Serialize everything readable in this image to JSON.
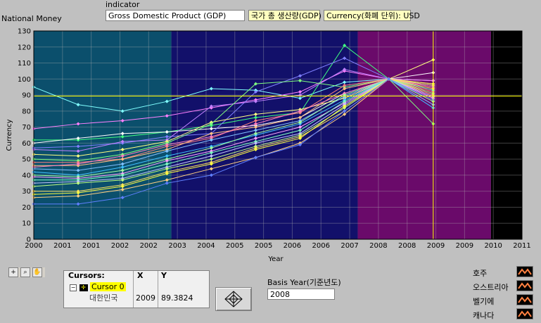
{
  "header": {
    "graph_title": "National Money",
    "indicator_label": "indicator",
    "indicator_value": "Gross Domestic Product (GDP)",
    "tag_korean": "국가 총 생산량(GDP)",
    "tag_currency": "Currency(화폐 단위): USD"
  },
  "chart_data": {
    "type": "line",
    "xlabel": "Year",
    "ylabel": "Currency",
    "xlim": [
      2000,
      2011
    ],
    "ylim": [
      0,
      130
    ],
    "x_ticks": [
      "2000",
      "2001",
      "2001",
      "2002",
      "2002",
      "2003",
      "2004",
      "2005",
      "2005",
      "2006",
      "2006",
      "2007",
      "2008",
      "2008",
      "2009",
      "2009",
      "2010",
      "2011"
    ],
    "y_ticks": [
      "0",
      "10",
      "20",
      "30",
      "40",
      "50",
      "60",
      "70",
      "80",
      "90",
      "100",
      "110",
      "120",
      "130"
    ],
    "x": [
      2000,
      2001,
      2002,
      2003,
      2004,
      2005,
      2006,
      2007,
      2008,
      2009
    ],
    "background_bands": [
      {
        "from": 2000,
        "to": 2003.1,
        "color": "#0b4f6c"
      },
      {
        "from": 2003.1,
        "to": 2007.3,
        "color": "#12106a"
      },
      {
        "from": 2007.3,
        "to": 2010.3,
        "color": "#6a0a6a"
      },
      {
        "from": 2010.3,
        "to": 2011,
        "color": "#000000"
      }
    ],
    "cursor": {
      "x": 2009,
      "y": 89.3824,
      "color": "#ffff00"
    },
    "series": [
      {
        "color": "#80ffff",
        "values": [
          95,
          84,
          80,
          86,
          94,
          93,
          88,
          98,
          100,
          99
        ]
      },
      {
        "color": "#ff80ff",
        "values": [
          69,
          72,
          74,
          77,
          82,
          87,
          92,
          105,
          100,
          99
        ]
      },
      {
        "color": "#40ff80",
        "values": [
          62,
          62,
          64,
          67,
          71,
          76,
          79,
          121,
          100,
          96
        ]
      },
      {
        "color": "#ffffff",
        "values": [
          60,
          63,
          66,
          67,
          69,
          71,
          76,
          91,
          100,
          104
        ]
      },
      {
        "color": "#8080ff",
        "values": [
          57,
          58,
          60,
          64,
          66,
          92,
          102,
          113,
          100,
          97
        ]
      },
      {
        "color": "#c080ff",
        "values": [
          56,
          55,
          61,
          62,
          83,
          86,
          90,
          106,
          100,
          95
        ]
      },
      {
        "color": "#ffff80",
        "values": [
          53,
          52,
          56,
          61,
          73,
          78,
          81,
          88,
          100,
          112
        ]
      },
      {
        "color": "#80ff80",
        "values": [
          50,
          49,
          53,
          60,
          72,
          97,
          99,
          95,
          100,
          72
        ]
      },
      {
        "color": "#ff8080",
        "values": [
          48,
          48,
          50,
          58,
          63,
          74,
          79,
          96,
          100,
          92
        ]
      },
      {
        "color": "#ffc080",
        "values": [
          46,
          46,
          50,
          56,
          66,
          70,
          76,
          94,
          100,
          90
        ]
      },
      {
        "color": "#ff80c0",
        "values": [
          45,
          47,
          52,
          59,
          64,
          72,
          80,
          91,
          100,
          95
        ]
      },
      {
        "color": "#80c0ff",
        "values": [
          44,
          43,
          47,
          55,
          62,
          68,
          74,
          89,
          100,
          84
        ]
      },
      {
        "color": "#40c0ff",
        "values": [
          42,
          40,
          45,
          52,
          58,
          65,
          72,
          87,
          100,
          82
        ]
      },
      {
        "color": "#a0ffa0",
        "values": [
          40,
          39,
          43,
          50,
          57,
          66,
          73,
          90,
          100,
          86
        ]
      },
      {
        "color": "#ffa0ff",
        "values": [
          39,
          38,
          41,
          49,
          55,
          63,
          70,
          85,
          100,
          88
        ]
      },
      {
        "color": "#80ffc0",
        "values": [
          37,
          37,
          40,
          47,
          54,
          61,
          68,
          86,
          100,
          93
        ]
      },
      {
        "color": "#c0c0ff",
        "values": [
          35,
          36,
          38,
          45,
          52,
          60,
          66,
          84,
          100,
          89
        ]
      },
      {
        "color": "#c0ff80",
        "values": [
          33,
          35,
          37,
          44,
          50,
          58,
          65,
          82,
          100,
          91
        ]
      },
      {
        "color": "#ffe060",
        "values": [
          30,
          30,
          34,
          42,
          48,
          57,
          64,
          80,
          100,
          94
        ]
      },
      {
        "color": "#ffff40",
        "values": [
          28,
          29,
          33,
          41,
          47,
          56,
          63,
          83,
          100,
          97
        ]
      },
      {
        "color": "#ffd080",
        "values": [
          26,
          27,
          31,
          37,
          44,
          51,
          60,
          78,
          100,
          96
        ]
      },
      {
        "color": "#6080ff",
        "values": [
          22,
          22,
          26,
          35,
          40,
          51,
          59,
          80,
          100,
          87
        ]
      }
    ]
  },
  "toolbar": {
    "cursor_tool": "+",
    "zoom_tool": "⌕",
    "pan_tool": "✋"
  },
  "cursor_panel": {
    "col_cursors": "Cursors:",
    "col_x": "X",
    "col_y": "Y",
    "cursor_name": "Cursor 0",
    "country": "대한민국",
    "x_value": "2009",
    "y_value": "89.3824"
  },
  "basis_year": {
    "label": "Basis Year(기준년도)",
    "value": "2008"
  },
  "legend": {
    "items": [
      {
        "label": "호주"
      },
      {
        "label": "오스트리아"
      },
      {
        "label": "벨기에"
      },
      {
        "label": "캐나다"
      }
    ],
    "swatch_color": "#ff8040"
  }
}
